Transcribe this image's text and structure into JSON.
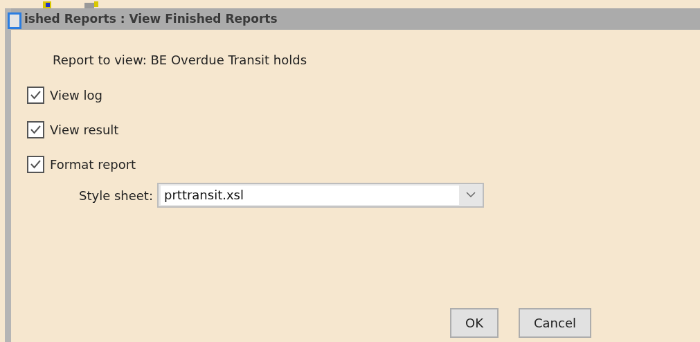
{
  "window": {
    "title": "ished Reports : View Finished Reports"
  },
  "report": {
    "label": "Report to view: BE Overdue Transit holds"
  },
  "options": [
    {
      "label": "View log",
      "checked": true
    },
    {
      "label": "View result",
      "checked": true
    },
    {
      "label": "Format report",
      "checked": true
    }
  ],
  "style_sheet": {
    "label": "Style sheet:",
    "value": "prttransit.xsl"
  },
  "buttons": [
    "OK",
    "Cancel"
  ]
}
